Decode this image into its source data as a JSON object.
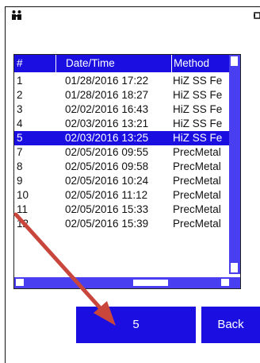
{
  "icons": {
    "top_left": "users-icon",
    "top_right": "battery-icon"
  },
  "table": {
    "headers": [
      "#",
      "Date/Time",
      "Method"
    ],
    "rows": [
      {
        "num": "1",
        "datetime": "01/28/2016 17:22",
        "method": "HiZ SS Fe"
      },
      {
        "num": "2",
        "datetime": "01/28/2016 18:27",
        "method": "HiZ SS Fe"
      },
      {
        "num": "3",
        "datetime": "02/02/2016 16:43",
        "method": "HiZ SS Fe"
      },
      {
        "num": "4",
        "datetime": "02/03/2016 13:21",
        "method": "HiZ SS Fe"
      },
      {
        "num": "5",
        "datetime": "02/03/2016 13:25",
        "method": "HiZ SS Fe"
      },
      {
        "num": "7",
        "datetime": "02/05/2016 09:55",
        "method": "PrecMetal"
      },
      {
        "num": "8",
        "datetime": "02/05/2016 09:58",
        "method": "PrecMetal"
      },
      {
        "num": "9",
        "datetime": "02/05/2016 10:24",
        "method": "PrecMetal"
      },
      {
        "num": "10",
        "datetime": "02/05/2016 11:12",
        "method": "PrecMetal"
      },
      {
        "num": "11",
        "datetime": "02/05/2016 15:33",
        "method": "PrecMetal"
      },
      {
        "num": "12",
        "datetime": "02/05/2016 15:39",
        "method": "PrecMetal"
      }
    ],
    "selected_row": 4
  },
  "buttons": {
    "selected_label": "5",
    "back_label": "Back"
  },
  "colors": {
    "accent": "#1a0fe0",
    "arrow": "#c9463c"
  }
}
